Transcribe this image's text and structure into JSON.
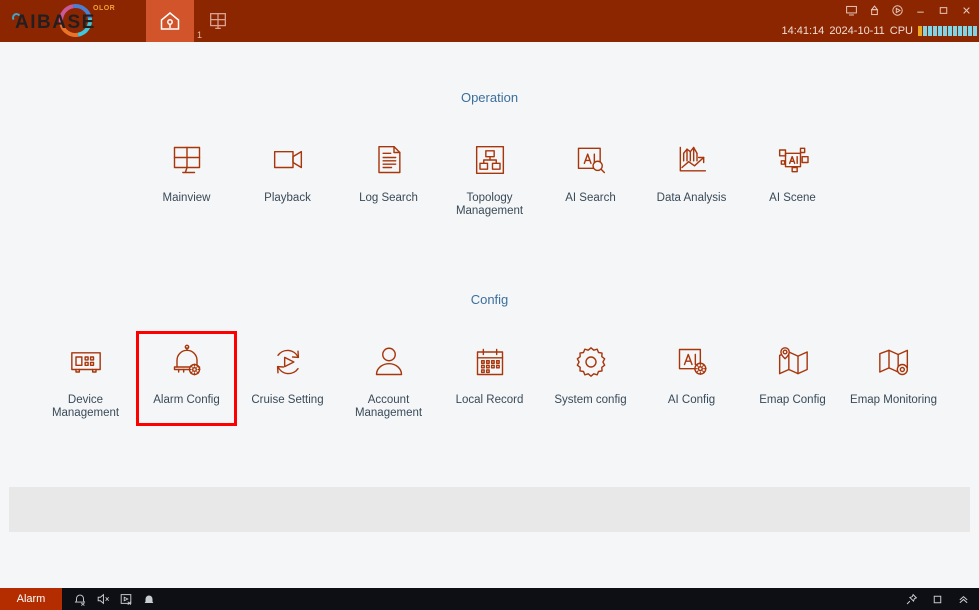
{
  "titlebar": {
    "logo_name": "AIBASE",
    "logo_sub": "OLOR",
    "tabs": [
      {
        "name": "home",
        "icon": "home-icon",
        "badge": "",
        "active": true
      },
      {
        "name": "layout",
        "icon": "grid-layout-icon",
        "badge": "1",
        "active": false
      }
    ],
    "window_controls": [
      {
        "name": "screen-icon",
        "icon": "monitor"
      },
      {
        "name": "user-lock-icon",
        "icon": "userlock"
      },
      {
        "name": "power-icon",
        "icon": "power"
      },
      {
        "name": "minimize-button",
        "icon": "minimize"
      },
      {
        "name": "maximize-button",
        "icon": "maximize"
      },
      {
        "name": "close-button",
        "icon": "close"
      }
    ],
    "status": {
      "time": "14:41:14",
      "date": "2024-10-11",
      "cpu_label": "CPU",
      "cpu_bars": 12,
      "cpu_hot_bars": 1,
      "cpu_color": "#7fd4e8",
      "cpu_hot_color": "#f0a81e"
    }
  },
  "sections": [
    {
      "id": "operation",
      "heading": "Operation",
      "tiles": [
        {
          "label": "Mainview",
          "icon": "mainview-grid-icon",
          "highlight": false
        },
        {
          "label": "Playback",
          "icon": "video-camera-icon",
          "highlight": false
        },
        {
          "label": "Log Search",
          "icon": "document-lines-icon",
          "highlight": false
        },
        {
          "label": "Topology Management",
          "icon": "topology-tree-icon",
          "highlight": false
        },
        {
          "label": "AI Search",
          "icon": "ai-search-icon",
          "highlight": false
        },
        {
          "label": "Data Analysis",
          "icon": "chart-analysis-icon",
          "highlight": false
        },
        {
          "label": "AI Scene",
          "icon": "ai-scene-icon",
          "highlight": false
        }
      ]
    },
    {
      "id": "config",
      "heading": "Config",
      "tiles": [
        {
          "label": "Device Management",
          "icon": "device-rack-icon",
          "highlight": false
        },
        {
          "label": "Alarm Config",
          "icon": "bell-gear-icon",
          "highlight": true
        },
        {
          "label": "Cruise Setting",
          "icon": "cruise-refresh-play-icon",
          "highlight": false
        },
        {
          "label": "Account Management",
          "icon": "user-person-icon",
          "highlight": false
        },
        {
          "label": "Local Record",
          "icon": "calendar-icon",
          "highlight": false
        },
        {
          "label": "System config",
          "icon": "gear-icon",
          "highlight": false
        },
        {
          "label": "AI Config",
          "icon": "ai-gear-icon",
          "highlight": false
        },
        {
          "label": "Emap Config",
          "icon": "map-pin-icon",
          "highlight": false
        },
        {
          "label": "Emap Monitoring",
          "icon": "map-target-icon",
          "highlight": false
        }
      ]
    }
  ],
  "bottombar": {
    "alarm_label": "Alarm",
    "left_icons": [
      {
        "name": "alarm-mute-icon"
      },
      {
        "name": "speaker-mute-icon"
      },
      {
        "name": "record-off-icon"
      },
      {
        "name": "bell-icon"
      }
    ],
    "right_icons": [
      {
        "name": "pin-icon"
      },
      {
        "name": "stop-square-icon"
      },
      {
        "name": "collapse-up-icon"
      }
    ]
  },
  "theme": {
    "titlebar_bg": "#8c2600",
    "tab_active_bg": "#d1542a",
    "icon_color": "#a8360c",
    "heading_color": "#3c6e9e",
    "label_color": "#3a4a58",
    "highlight_color": "#ff0000",
    "page_bg": "#f4f6f7",
    "panel_bg": "#e8e8e8",
    "bottombar_bg": "#0d0f14",
    "alarm_bg": "#b32d00"
  }
}
